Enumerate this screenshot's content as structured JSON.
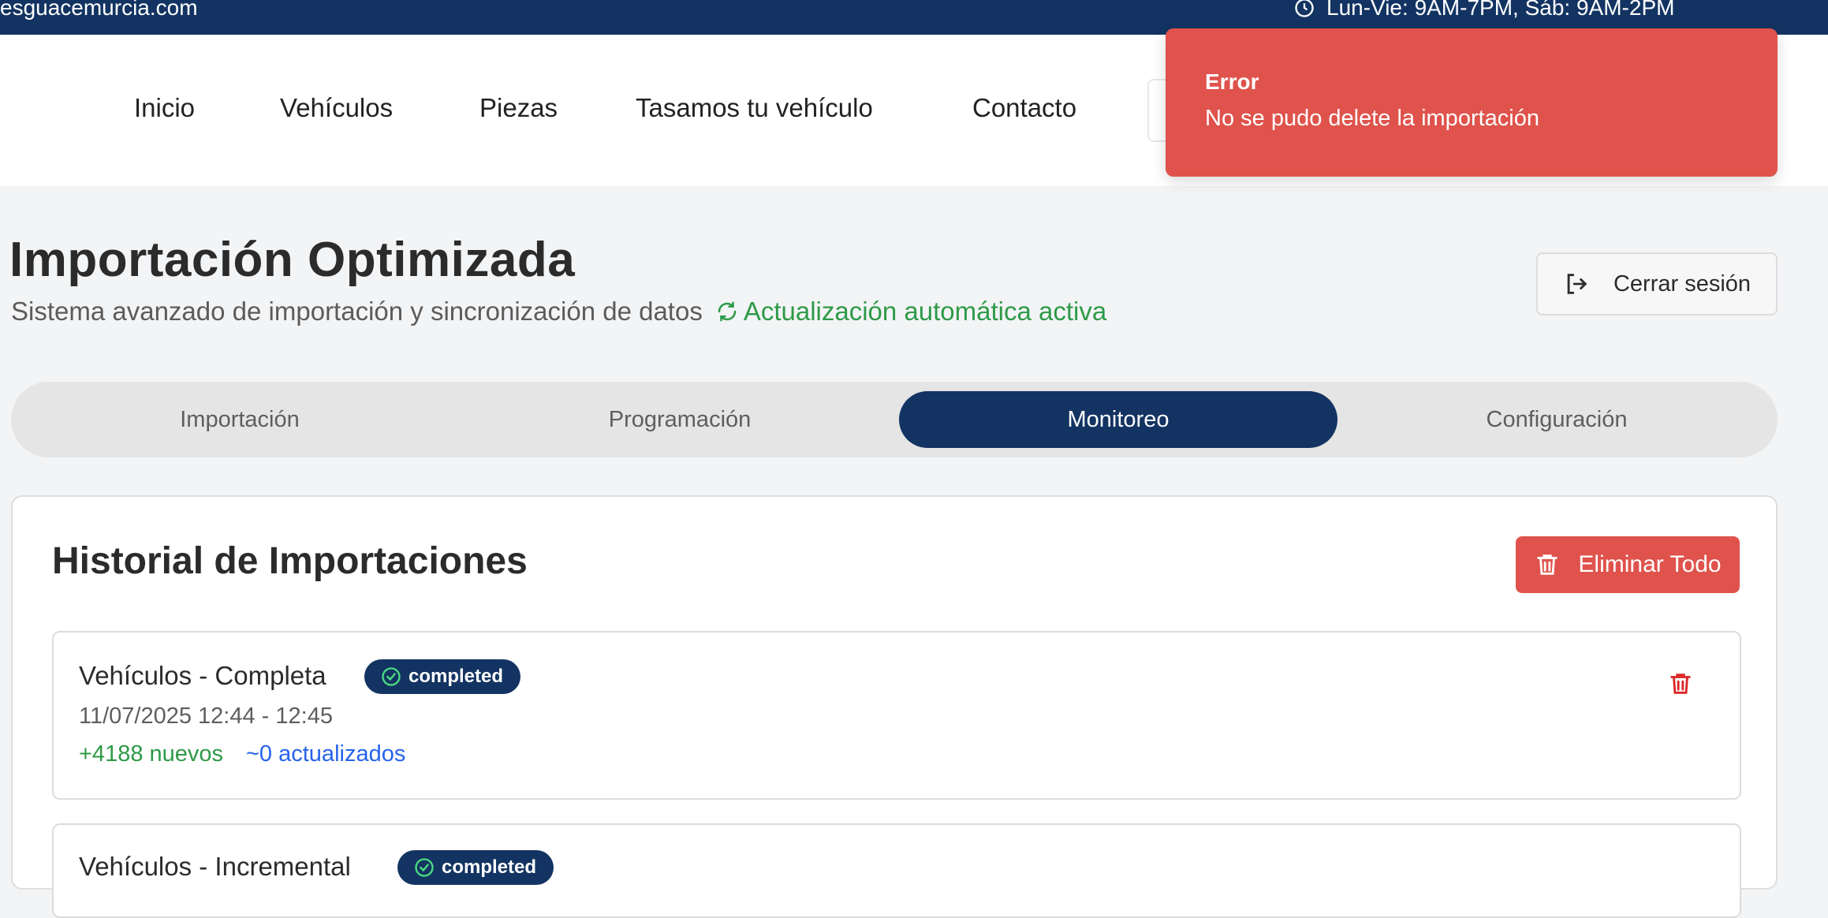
{
  "topbar": {
    "site": "esguacemurcia.com",
    "hours": "Lun-Vie: 9AM-7PM, Sáb: 9AM-2PM"
  },
  "nav": {
    "links": [
      "Inicio",
      "Vehículos",
      "Piezas",
      "Tasamos tu vehículo",
      "Contacto"
    ]
  },
  "toast": {
    "title": "Error",
    "message": "No se pudo delete la importación",
    "color": "#df534c"
  },
  "header": {
    "title": "Importación Optimizada",
    "subtitle": "Sistema avanzado de importación y sincronización de datos",
    "auto_update": "Actualización automática activa",
    "logout_label": "Cerrar sesión"
  },
  "tabs": [
    {
      "label": "Importación",
      "active": false
    },
    {
      "label": "Programación",
      "active": false
    },
    {
      "label": "Monitoreo",
      "active": true
    },
    {
      "label": "Configuración",
      "active": false
    }
  ],
  "history": {
    "title": "Historial de Importaciones",
    "delete_all_label": "Eliminar Todo",
    "items": [
      {
        "name": "Vehículos - Completa",
        "status": "completed",
        "time": "11/07/2025 12:44 - 12:45",
        "new": "+4188 nuevos",
        "updated": "~0 actualizados"
      },
      {
        "name": "Vehículos - Incremental",
        "status": "completed"
      }
    ]
  },
  "colors": {
    "brand_navy": "#133462",
    "danger": "#df534c",
    "success": "#2e9a47",
    "link_blue": "#2563eb"
  }
}
